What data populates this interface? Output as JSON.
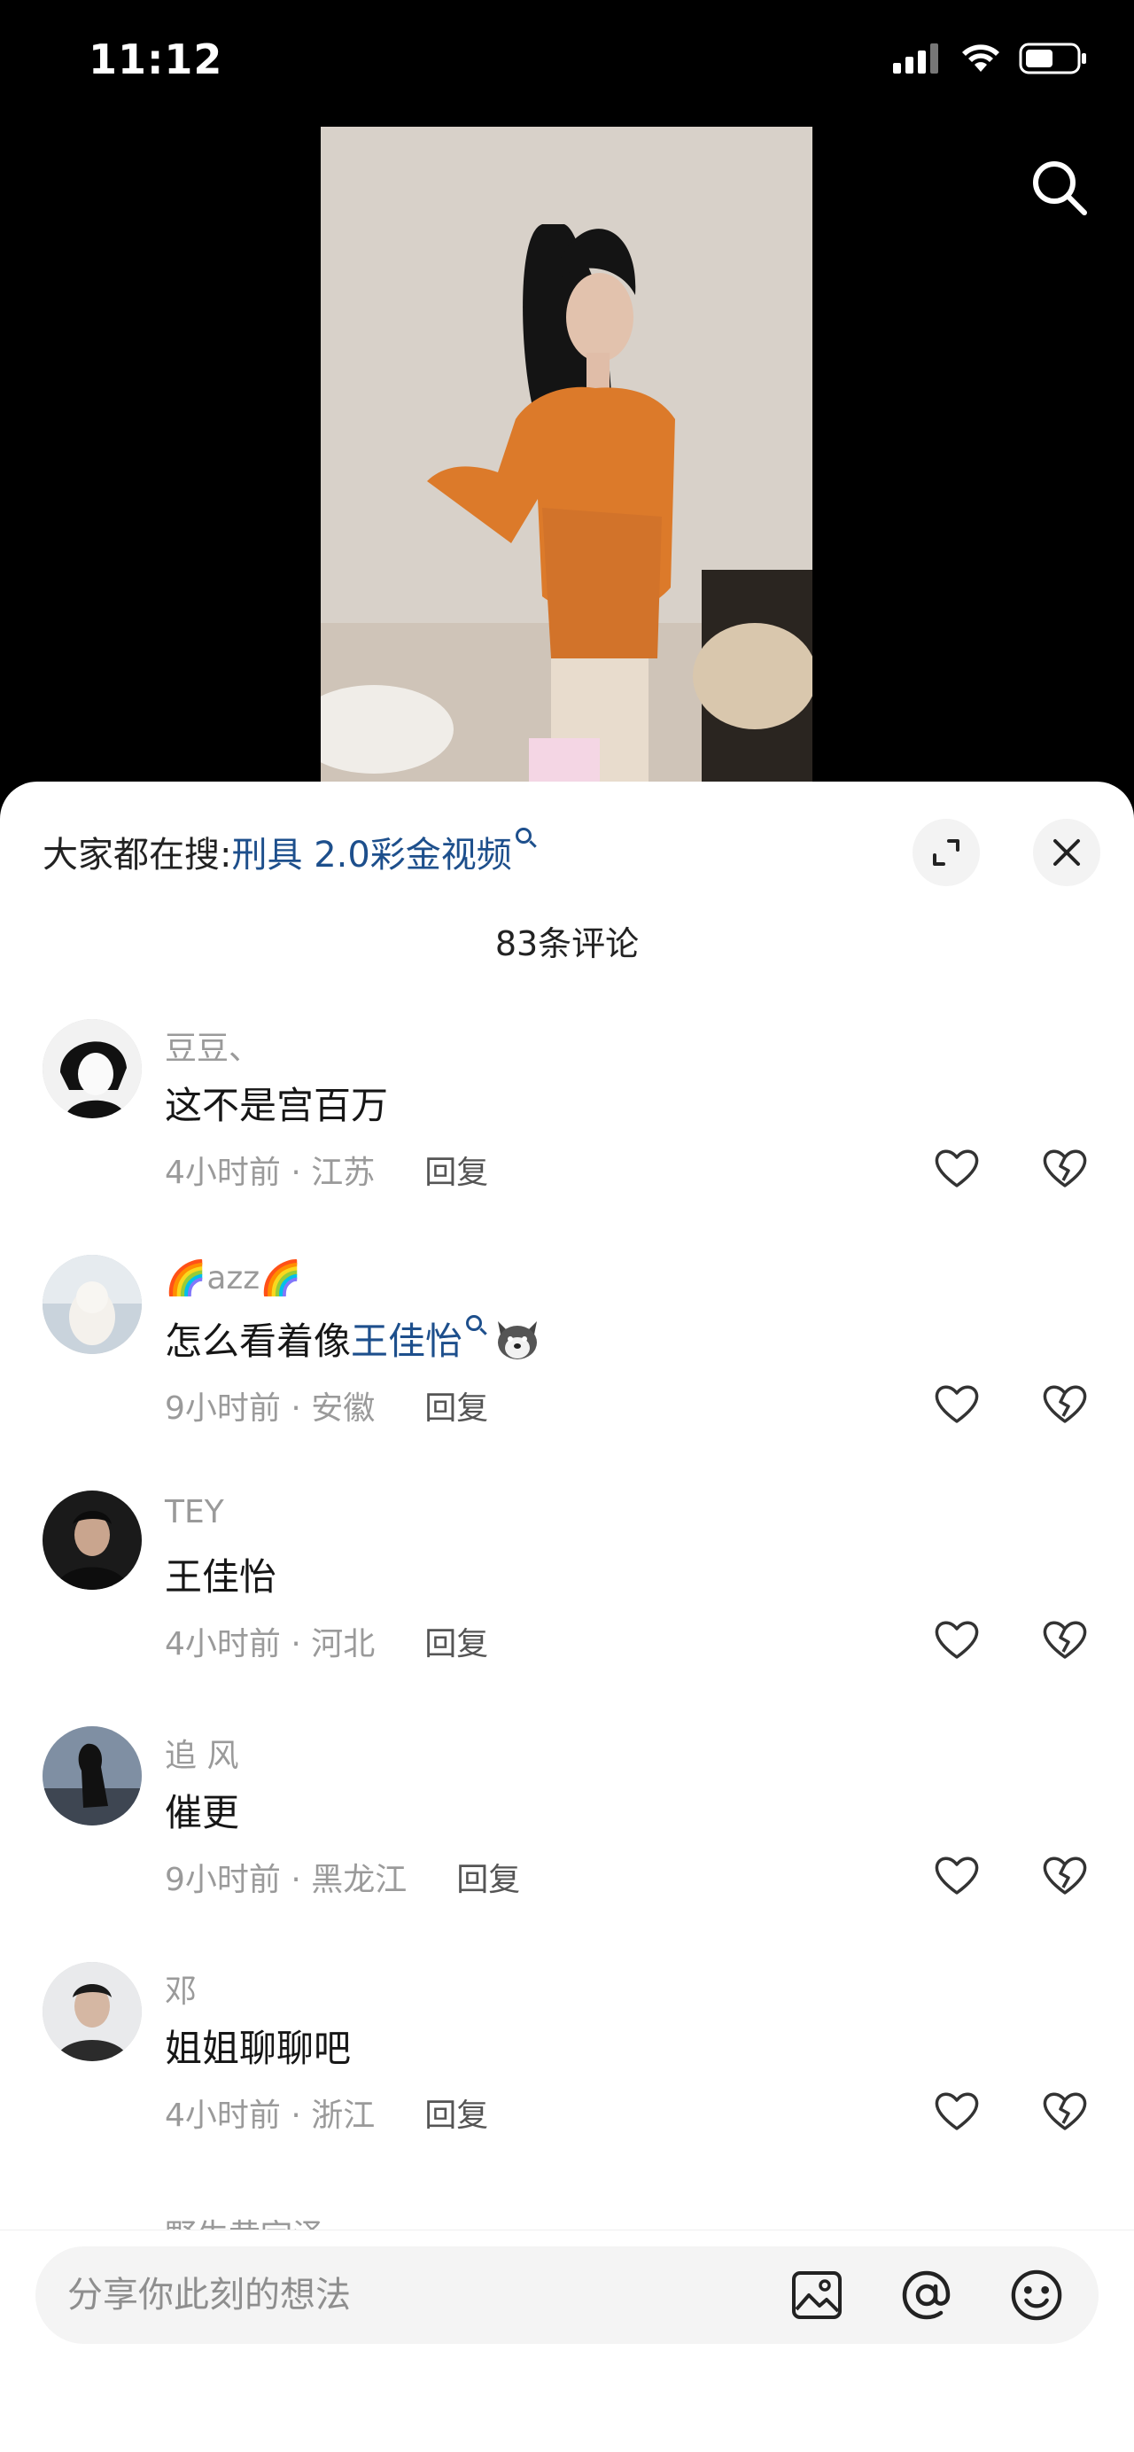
{
  "status": {
    "time": "11:12"
  },
  "sheet": {
    "hot_search_prefix": "大家都在搜:",
    "hot_search_term": "刑具 2.0彩金视频",
    "comment_count": "83条评论"
  },
  "comments": [
    {
      "user": "豆豆、",
      "text": "这不是宫百万",
      "highlight": "",
      "time_loc": "4小时前 · 江苏",
      "reply": "回复"
    },
    {
      "user": "azz",
      "text": "怎么看着像",
      "highlight": "王佳怡",
      "time_loc": "9小时前 · 安徽",
      "reply": "回复"
    },
    {
      "user": "TEY",
      "text": "王佳怡",
      "highlight": "",
      "time_loc": "4小时前 · 河北",
      "reply": "回复"
    },
    {
      "user": "追 风",
      "text": "催更",
      "highlight": "",
      "time_loc": "9小时前 · 黑龙江",
      "reply": "回复"
    },
    {
      "user": "邓",
      "text": "姐姐聊聊吧",
      "highlight": "",
      "time_loc": "4小时前 · 浙江",
      "reply": "回复"
    }
  ],
  "peek_user": "野生黄宇泽",
  "input": {
    "placeholder": "分享你此刻的想法"
  },
  "icons": {
    "search": "search-icon",
    "expand": "expand-icon",
    "close": "close-icon",
    "like": "heart-icon",
    "dislike": "broken-heart-icon",
    "image": "image-icon",
    "mention": "at-icon",
    "emoji": "emoji-icon"
  },
  "colors": {
    "link": "#1d4f8c",
    "meta": "#9a9a9a"
  }
}
